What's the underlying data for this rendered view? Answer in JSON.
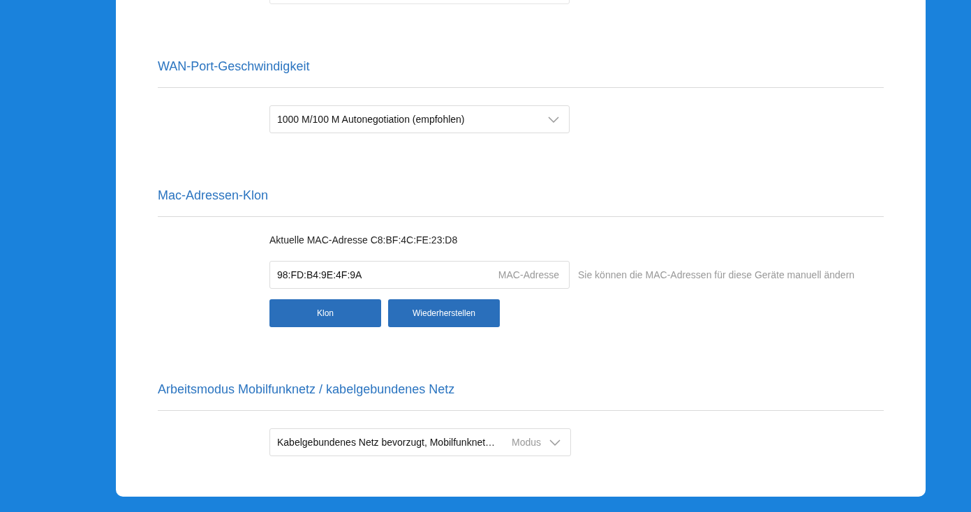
{
  "sections": [
    {
      "kind": "select",
      "title": "WAN-Port-Geschwindigkeit",
      "select": {
        "value": "1000 M/100 M Autonegotiation (empfohlen)"
      }
    },
    {
      "kind": "mac-clone",
      "title": "Mac-Adressen-Klon",
      "current_mac": "Aktuelle MAC-Adresse C8:BF:4C:FE:23:D8",
      "field": {
        "value": "98:FD:B4:9E:4F:9A",
        "label": "MAC-Adresse"
      },
      "hint": "Sie können die MAC-Adressen für diese Geräte manuell ändern",
      "buttons": [
        "Klon",
        "Wiederherstellen"
      ]
    },
    {
      "kind": "select",
      "title": "Arbeitsmodus Mobilfunknetz / kabelgebundenes Netz",
      "select": {
        "value": "Kabelgebundenes Netz bevorzugt, Mobilfunknet…",
        "label": "Modus"
      }
    }
  ]
}
